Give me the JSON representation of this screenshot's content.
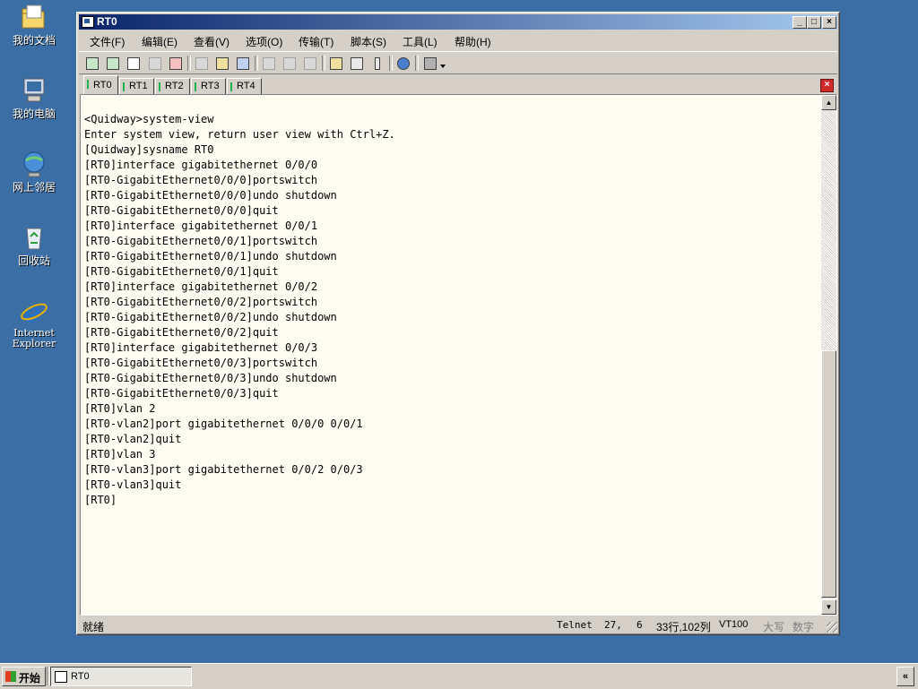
{
  "desktop": {
    "icons": [
      {
        "label": "我的文档",
        "icon": "folder-icon"
      },
      {
        "label": "我的电脑",
        "icon": "computer-icon"
      },
      {
        "label": "网上邻居",
        "icon": "network-icon"
      },
      {
        "label": "回收站",
        "icon": "recycle-bin-icon"
      },
      {
        "label": "Internet Explorer",
        "icon": "ie-icon"
      }
    ]
  },
  "window": {
    "title": "RT0",
    "minimize": "_",
    "maximize": "□",
    "close": "×"
  },
  "menu": [
    "文件(F)",
    "编辑(E)",
    "查看(V)",
    "选项(O)",
    "传输(T)",
    "脚本(S)",
    "工具(L)",
    "帮助(H)"
  ],
  "tabs": [
    "RT0",
    "RT1",
    "RT2",
    "RT3",
    "RT4"
  ],
  "active_tab": "RT0",
  "terminal": {
    "lines": [
      "<Quidway>system-view",
      "Enter system view, return user view with Ctrl+Z.",
      "[Quidway]sysname RT0",
      "[RT0]interface gigabitethernet 0/0/0",
      "[RT0-GigabitEthernet0/0/0]portswitch",
      "[RT0-GigabitEthernet0/0/0]undo shutdown",
      "[RT0-GigabitEthernet0/0/0]quit",
      "[RT0]interface gigabitethernet 0/0/1",
      "[RT0-GigabitEthernet0/0/1]portswitch",
      "[RT0-GigabitEthernet0/0/1]undo shutdown",
      "[RT0-GigabitEthernet0/0/1]quit",
      "[RT0]interface gigabitethernet 0/0/2",
      "[RT0-GigabitEthernet0/0/2]portswitch",
      "[RT0-GigabitEthernet0/0/2]undo shutdown",
      "[RT0-GigabitEthernet0/0/2]quit",
      "[RT0]interface gigabitethernet 0/0/3",
      "[RT0-GigabitEthernet0/0/3]portswitch",
      "[RT0-GigabitEthernet0/0/3]undo shutdown",
      "[RT0-GigabitEthernet0/0/3]quit",
      "[RT0]vlan 2",
      "[RT0-vlan2]port gigabitethernet 0/0/0 0/0/1",
      "[RT0-vlan2]quit",
      "[RT0]vlan 3",
      "[RT0-vlan3]port gigabitethernet 0/0/2 0/0/3",
      "[RT0-vlan3]quit",
      "[RT0]"
    ]
  },
  "status": {
    "ready": "就绪",
    "protocol": "Telnet",
    "row": "27,",
    "col": "6",
    "size": "33行,102列",
    "emulation": "VT100",
    "caps": "大写",
    "num": "数字"
  },
  "taskbar": {
    "start": "开始",
    "task_title": "RT0",
    "tray_toggle": "«"
  }
}
